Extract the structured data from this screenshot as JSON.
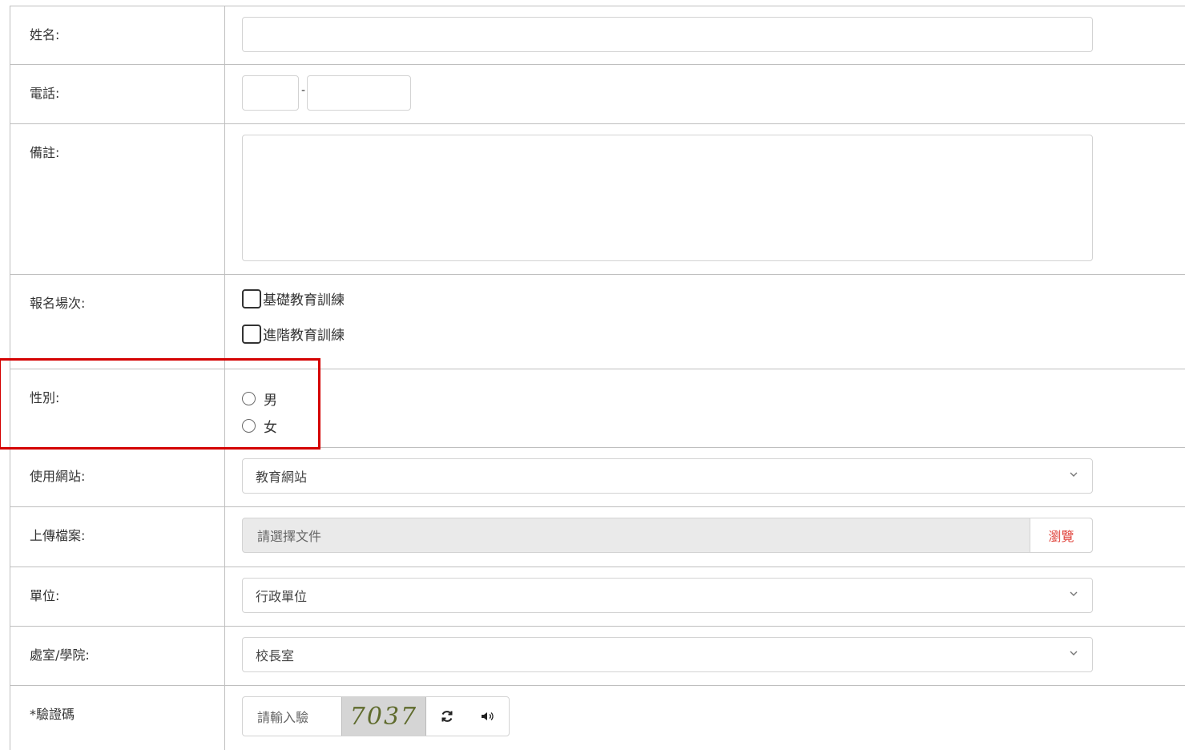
{
  "fields": {
    "name_label": "姓名:",
    "phone_label": "電話:",
    "phone_separator": "-",
    "note_label": "備註:",
    "session_label": "報名場次:",
    "session_options": [
      "基礎教育訓練",
      "進階教育訓練"
    ],
    "gender_label": "性別:",
    "gender_options": [
      "男",
      "女"
    ],
    "website_label": "使用網站:",
    "website_value": "教育網站",
    "upload_label": "上傳檔案:",
    "upload_placeholder": "請選擇文件",
    "upload_button": "瀏覽",
    "unit_label": "單位:",
    "unit_value": "行政單位",
    "office_label": "處室/學院:",
    "office_value": "校長室",
    "captcha_label": "*驗證碼",
    "captcha_placeholder": "請輸入驗",
    "captcha_code": "7037"
  },
  "icons": {
    "refresh": "refresh-icon",
    "audio": "speaker-icon",
    "dropdown": "chevron-down-icon"
  },
  "colors": {
    "highlight": "#d40000",
    "browse_text": "#e0443c",
    "border": "#bfbfbf"
  }
}
